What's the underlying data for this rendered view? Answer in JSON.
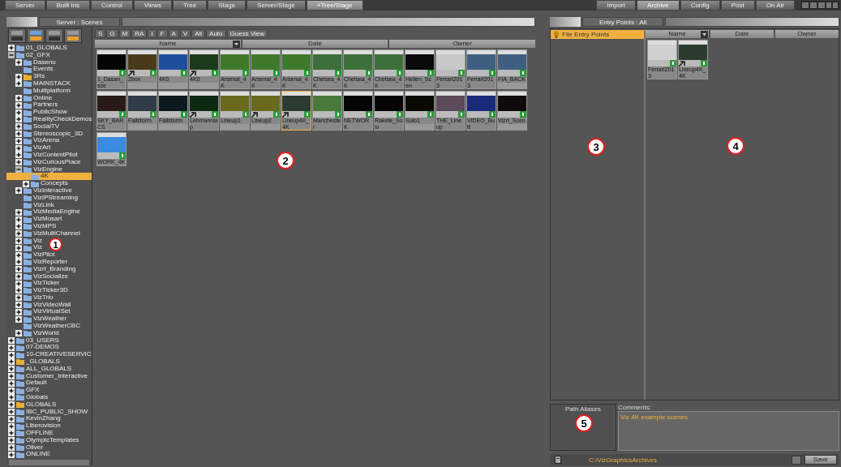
{
  "top_tabs": [
    {
      "label": "Server",
      "selected": false
    },
    {
      "label": "Built Ins",
      "selected": false
    },
    {
      "label": "Control",
      "selected": false
    },
    {
      "label": "Views",
      "selected": false
    },
    {
      "label": "Tree",
      "selected": false
    },
    {
      "label": "Stage",
      "selected": false
    },
    {
      "label": "Server/Stage",
      "selected": false
    },
    {
      "label": "+Tree/Stage",
      "selected": true
    }
  ],
  "mode_tabs": [
    {
      "label": "Import",
      "selected": false
    },
    {
      "label": "Archive",
      "selected": true
    },
    {
      "label": "Config",
      "selected": false
    },
    {
      "label": "Post",
      "selected": false
    },
    {
      "label": "On Air",
      "selected": false
    }
  ],
  "server_panel": {
    "title": "Server : Scenes",
    "tree": [
      {
        "label": "01_GLOBALS",
        "kind": "folder",
        "expanded": false,
        "selected": false
      },
      {
        "label": "02_GFX",
        "kind": "folder",
        "expanded": true,
        "selected": false,
        "children": [
          {
            "label": "Dasenu",
            "kind": "folder",
            "expanded": false,
            "selected": false
          },
          {
            "label": "Events",
            "kind": "folder",
            "selected": false
          },
          {
            "label": "3Rs",
            "kind": "folder-yellow",
            "expanded": false,
            "selected": false
          },
          {
            "label": "MAINSTACK",
            "kind": "folder",
            "expanded": false,
            "selected": false
          },
          {
            "label": "Multiplatform",
            "kind": "folder",
            "selected": false
          },
          {
            "label": "Online",
            "kind": "folder",
            "expanded": false,
            "selected": false
          },
          {
            "label": "Partners",
            "kind": "folder",
            "expanded": false,
            "selected": false
          },
          {
            "label": "PublicShow",
            "kind": "folder",
            "expanded": false,
            "selected": false
          },
          {
            "label": "RealityCheckDemos",
            "kind": "folder",
            "expanded": false,
            "selected": false
          },
          {
            "label": "SocialTV",
            "kind": "folder",
            "expanded": false,
            "selected": false
          },
          {
            "label": "Stereoscopic_3D",
            "kind": "folder",
            "expanded": false,
            "selected": false
          },
          {
            "label": "VizArena",
            "kind": "folder",
            "expanded": false,
            "selected": false
          },
          {
            "label": "VizArt",
            "kind": "folder",
            "expanded": false,
            "selected": false
          },
          {
            "label": "VizContentPilot",
            "kind": "folder",
            "expanded": false,
            "selected": false
          },
          {
            "label": "VizCuriousPlace",
            "kind": "folder",
            "expanded": false,
            "selected": false
          },
          {
            "label": "VizEngine",
            "kind": "folder",
            "expanded": true,
            "selected": false,
            "children": [
              {
                "label": "4K",
                "kind": "folder",
                "selected": true
              },
              {
                "label": "Concepts",
                "kind": "folder",
                "expanded": false,
                "selected": false
              }
            ]
          },
          {
            "label": "VizInteractive",
            "kind": "folder",
            "expanded": false,
            "selected": false
          },
          {
            "label": "VizIPStreaming",
            "kind": "folder",
            "selected": false
          },
          {
            "label": "VizLink",
            "kind": "folder",
            "selected": false
          },
          {
            "label": "VizMediaEngine",
            "kind": "folder",
            "expanded": false,
            "selected": false
          },
          {
            "label": "VizMosart",
            "kind": "folder",
            "expanded": false,
            "selected": false
          },
          {
            "label": "VizMPS",
            "kind": "folder",
            "expanded": false,
            "selected": false
          },
          {
            "label": "VizMultiChannel",
            "kind": "folder",
            "expanded": false,
            "selected": false
          },
          {
            "label": "Viz",
            "kind": "folder",
            "expanded": false,
            "selected": false
          },
          {
            "label": "Viz",
            "kind": "folder",
            "expanded": false,
            "selected": false
          },
          {
            "label": "VizPilot",
            "kind": "folder",
            "expanded": false,
            "selected": false
          },
          {
            "label": "VizReporter",
            "kind": "folder",
            "expanded": false,
            "selected": false
          },
          {
            "label": "Vizrt_Branding",
            "kind": "folder",
            "expanded": false,
            "selected": false
          },
          {
            "label": "VizSocialize",
            "kind": "folder",
            "expanded": false,
            "selected": false
          },
          {
            "label": "VizTicker",
            "kind": "folder",
            "expanded": false,
            "selected": false
          },
          {
            "label": "VizTicker3D",
            "kind": "folder",
            "expanded": false,
            "selected": false
          },
          {
            "label": "VizTrio",
            "kind": "folder",
            "expanded": false,
            "selected": false
          },
          {
            "label": "VizVideoWall",
            "kind": "folder",
            "expanded": false,
            "selected": false
          },
          {
            "label": "VizVirtualSet",
            "kind": "folder",
            "expanded": false,
            "selected": false
          },
          {
            "label": "VizWeather",
            "kind": "folder",
            "expanded": false,
            "selected": false
          },
          {
            "label": "VizWeatherCBC",
            "kind": "folder",
            "selected": false
          },
          {
            "label": "VizWorld",
            "kind": "folder",
            "expanded": false,
            "selected": false
          }
        ]
      },
      {
        "label": "03_USERS",
        "kind": "folder",
        "expanded": false,
        "selected": false
      },
      {
        "label": "07-DEMOS",
        "kind": "folder",
        "expanded": false,
        "selected": false
      },
      {
        "label": "10-CREATIVESERVIC",
        "kind": "folder",
        "expanded": false,
        "selected": false
      },
      {
        "label": "_GLOBALS",
        "kind": "folder-yellow",
        "expanded": false,
        "selected": false
      },
      {
        "label": "ALL_GLOBALS",
        "kind": "folder",
        "expanded": false,
        "selected": false
      },
      {
        "label": "Customer_Interactive",
        "kind": "folder",
        "expanded": false,
        "selected": false
      },
      {
        "label": "Default",
        "kind": "folder",
        "expanded": false,
        "selected": false
      },
      {
        "label": "GFX",
        "kind": "folder",
        "expanded": false,
        "selected": false
      },
      {
        "label": "Globals",
        "kind": "folder",
        "expanded": false,
        "selected": false
      },
      {
        "label": "GLOBALS",
        "kind": "folder-yellow",
        "expanded": false,
        "selected": false
      },
      {
        "label": "IBC_PUBLIC_SHOW",
        "kind": "folder",
        "expanded": false,
        "selected": false
      },
      {
        "label": "KevinZhang",
        "kind": "folder",
        "expanded": false,
        "selected": false
      },
      {
        "label": "Liberovision",
        "kind": "folder",
        "expanded": false,
        "selected": false
      },
      {
        "label": "OFFLINE",
        "kind": "folder",
        "expanded": false,
        "selected": false
      },
      {
        "label": "OlympicTemplates",
        "kind": "folder",
        "expanded": false,
        "selected": false
      },
      {
        "label": "Oliver",
        "kind": "folder",
        "expanded": false,
        "selected": false
      },
      {
        "label": "ONLINE",
        "kind": "folder",
        "expanded": false,
        "selected": false
      }
    ],
    "filters": [
      "S",
      "G",
      "M",
      "RA",
      "I",
      "F",
      "A",
      "V",
      "All",
      "Auto",
      "Guess View"
    ],
    "columns": [
      "Name",
      "Date",
      "Owner"
    ],
    "scenes": [
      {
        "label": "1_Dasan_sce",
        "color": "#050505",
        "linked": false,
        "selected": false
      },
      {
        "label": "2box",
        "color": "#4a3a1c",
        "linked": true,
        "selected": false
      },
      {
        "label": "4K0",
        "color": "#1f4f9a",
        "linked": false,
        "selected": false
      },
      {
        "label": "4K0",
        "color": "#1b3a1b",
        "linked": true,
        "selected": false
      },
      {
        "label": "Arsenal_4K",
        "color": "#3f7a2a",
        "linked": false,
        "selected": false
      },
      {
        "label": "Arsenal_4K",
        "color": "#3f7a2a",
        "linked": false,
        "selected": false
      },
      {
        "label": "Arsenal_4K",
        "color": "#3f7a2a",
        "linked": false,
        "selected": false
      },
      {
        "label": "Chelsea_4K",
        "color": "#3c6f3a",
        "linked": false,
        "selected": false
      },
      {
        "label": "Chelsea_4K",
        "color": "#3c6f3a",
        "linked": false,
        "selected": false
      },
      {
        "label": "Chelsea_4K",
        "color": "#3c6f3a",
        "linked": false,
        "selected": false
      },
      {
        "label": "Hellen_Scen",
        "color": "#0a0a0a",
        "linked": false,
        "selected": false
      },
      {
        "label": "Ferrari2013",
        "color": "#c8c8c8",
        "linked": false,
        "selected": false
      },
      {
        "label": "Ferrari2013",
        "color": "#3e5f80",
        "linked": false,
        "selected": false
      },
      {
        "label": "FIA_BACK",
        "color": "#3e5f80",
        "linked": false,
        "selected": false
      },
      {
        "label": "SKY_BARCS",
        "color": "#2a1a18",
        "linked": false,
        "selected": false
      },
      {
        "label": "Fallstorm",
        "color": "#2f3c48",
        "linked": false,
        "selected": false
      },
      {
        "label": "Fallstorm",
        "color": "#0c1a20",
        "linked": false,
        "selected": false
      },
      {
        "label": "Lehmannlap",
        "color": "#0e2a10",
        "linked": true,
        "selected": false
      },
      {
        "label": "Lineup1",
        "color": "#6a6a1e",
        "linked": false,
        "selected": false
      },
      {
        "label": "Lineup2",
        "color": "#6a6a1e",
        "linked": true,
        "selected": false
      },
      {
        "label": "Lineup4K_4K",
        "color": "#2c3a30",
        "linked": true,
        "selected": true
      },
      {
        "label": "Manchester",
        "color": "#4a7a3a",
        "linked": false,
        "selected": false
      },
      {
        "label": "NETWORK",
        "color": "#050505",
        "linked": false,
        "selected": false
      },
      {
        "label": "Rakete_Solo",
        "color": "#050505",
        "linked": false,
        "selected": false
      },
      {
        "label": "Solo1",
        "color": "#0a0a05",
        "linked": false,
        "selected": false
      },
      {
        "label": "THE_Lineup",
        "color": "#5a4a5a",
        "linked": false,
        "selected": false
      },
      {
        "label": "VIDEO_Butt",
        "color": "#1a2a7a",
        "linked": false,
        "selected": false
      },
      {
        "label": "Vizrt_Scen",
        "color": "#100a08",
        "linked": false,
        "selected": false
      },
      {
        "label": "WORK_4K",
        "color": "#3a8ae0",
        "linked": false,
        "selected": false
      }
    ]
  },
  "entry_panel": {
    "title": "Entry Points : All",
    "entries": [
      {
        "label": "File Entry Points",
        "selected": true
      }
    ],
    "columns": [
      "Name",
      "Date",
      "Owner"
    ],
    "scenes": [
      {
        "label": "Ferrari2013",
        "color": "#d0d0d0",
        "linked": false,
        "selected": false
      },
      {
        "label": "Lineup4K_4K",
        "color": "#2c3a30",
        "linked": true,
        "selected": false
      }
    ],
    "path_aliases_label": "Path Aliases",
    "comments_label": "Comments:",
    "comment": "Viz 4K example scenes",
    "path": "C:/VizGraphicsArchives",
    "save": "Save"
  },
  "callouts": [
    "1",
    "2",
    "3",
    "4",
    "5"
  ]
}
